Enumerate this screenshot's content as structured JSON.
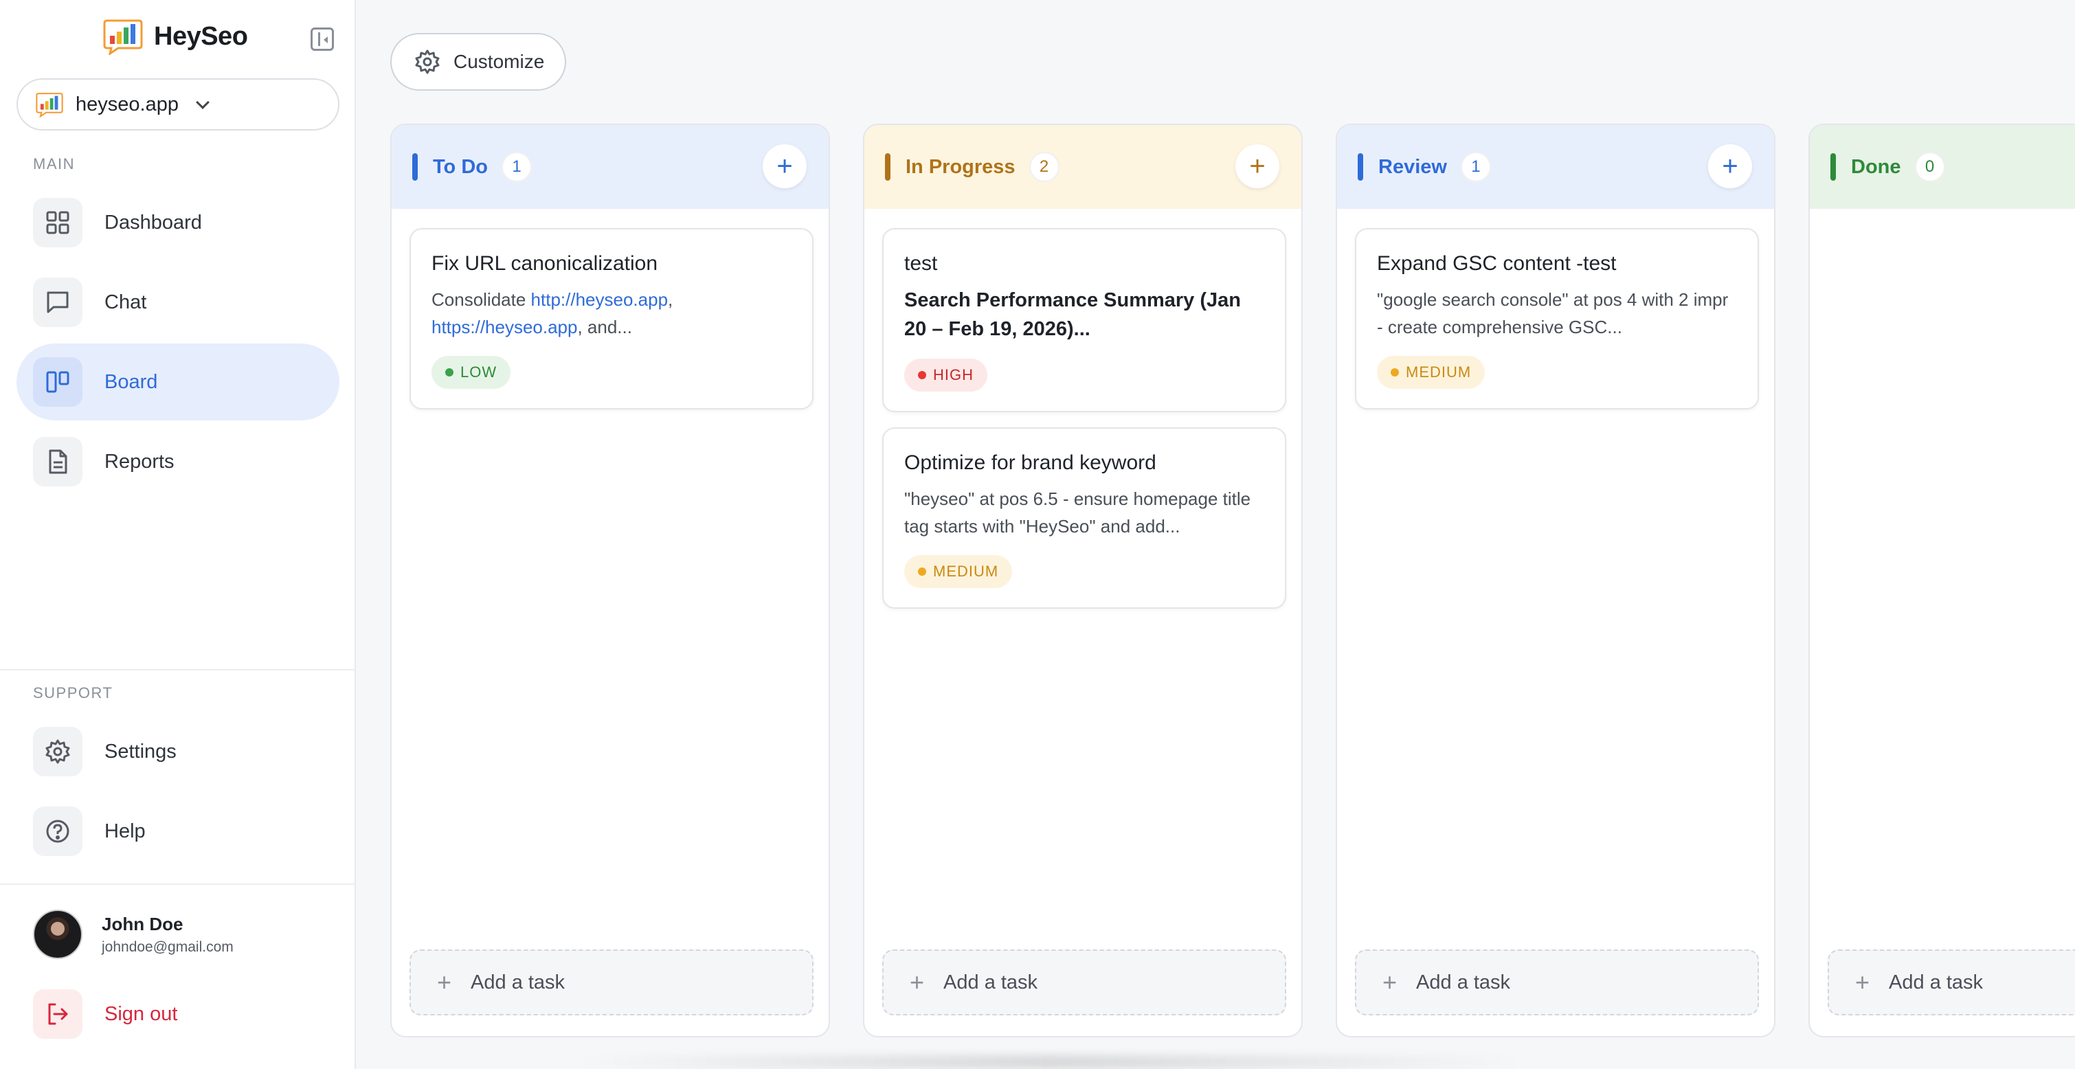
{
  "brand": {
    "name": "HeySeo"
  },
  "site_selector": {
    "value": "heyseo.app"
  },
  "sidebar": {
    "main_label": "MAIN",
    "support_label": "SUPPORT",
    "items": [
      {
        "label": "Dashboard",
        "icon": "grid-icon"
      },
      {
        "label": "Chat",
        "icon": "chat-icon"
      },
      {
        "label": "Board",
        "icon": "board-icon",
        "active": true
      },
      {
        "label": "Reports",
        "icon": "document-icon"
      }
    ],
    "support_items": [
      {
        "label": "Settings",
        "icon": "gear-icon"
      },
      {
        "label": "Help",
        "icon": "help-icon"
      }
    ],
    "user": {
      "name": "John Doe",
      "email": "johndoe@gmail.com"
    },
    "signout_label": "Sign out"
  },
  "toolbar": {
    "customize_label": "Customize"
  },
  "columns": [
    {
      "title": "To Do",
      "count": "1",
      "color": "#2f6bd8",
      "head_bg": "#e8effc",
      "cards": [
        {
          "title": "Fix URL canonicalization",
          "desc_prefix": "Consolidate ",
          "link1": "http://heyseo.app",
          "sep": ",",
          "link2": "https://heyseo.app",
          "desc_suffix": ", and...",
          "priority": "LOW"
        }
      ],
      "add_label": "Add a task"
    },
    {
      "title": "In Progress",
      "count": "2",
      "color": "#b0731a",
      "head_bg": "#fdf5e0",
      "cards": [
        {
          "title": "test",
          "subtitle": "Search Performance Summary (Jan 20 – Feb 19, 2026)...",
          "priority": "HIGH"
        },
        {
          "title": "Optimize for brand keyword",
          "desc": "\"heyseo\" at pos 6.5 - ensure homepage title tag starts with \"HeySeo\" and add...",
          "priority": "MEDIUM"
        }
      ],
      "add_label": "Add a task"
    },
    {
      "title": "Review",
      "count": "1",
      "color": "#2f6bd8",
      "head_bg": "#e8effc",
      "cards": [
        {
          "title": "Expand GSC content -test",
          "desc": "\"google search console\" at pos 4 with 2 impr - create comprehensive GSC...",
          "priority": "MEDIUM"
        }
      ],
      "add_label": "Add a task"
    },
    {
      "title": "Done",
      "count": "0",
      "color": "#2e8a3a",
      "head_bg": "#e7f3e6",
      "cards": [],
      "add_label": "Add a task"
    }
  ],
  "priority_colors": {
    "LOW": {
      "bg": "#e6f4e7",
      "fg": "#2e8a3a",
      "dot": "#3aa24a"
    },
    "HIGH": {
      "bg": "#fde8e8",
      "fg": "#c62828",
      "dot": "#e53935"
    },
    "MEDIUM": {
      "bg": "#fdf3dc",
      "fg": "#c98a12",
      "dot": "#efa821"
    }
  }
}
